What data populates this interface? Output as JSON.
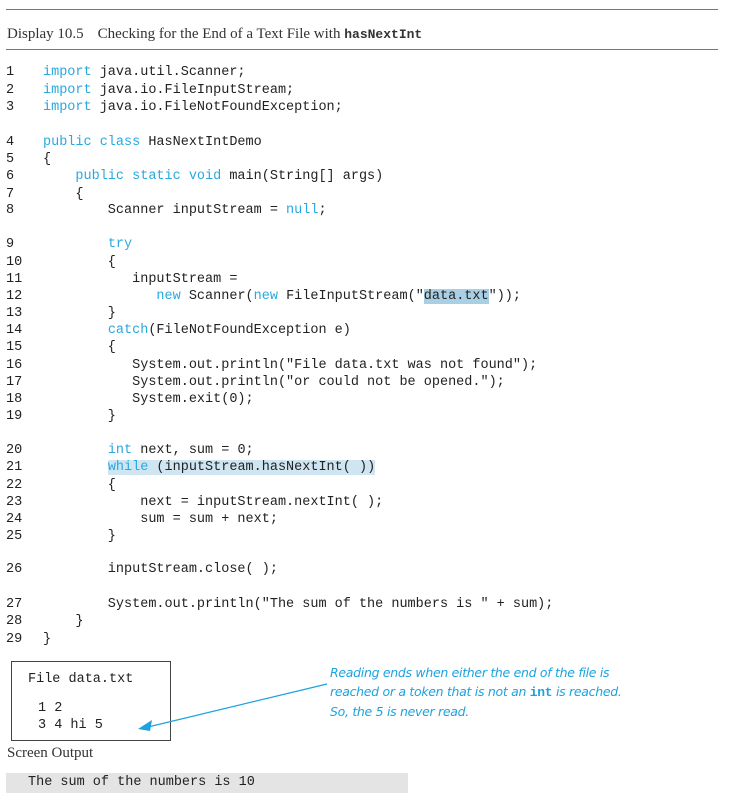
{
  "header": {
    "display_number": "Display 10.5",
    "title_text": "Checking for the End of a Text File with ",
    "title_code": "hasNextInt"
  },
  "code_lines": [
    {
      "n": "1",
      "parts": [
        {
          "t": "import",
          "k": 1
        },
        {
          "t": " java.util.Scanner;"
        }
      ]
    },
    {
      "n": "2",
      "parts": [
        {
          "t": "import",
          "k": 1
        },
        {
          "t": " java.io.FileInputStream;"
        }
      ]
    },
    {
      "n": "3",
      "parts": [
        {
          "t": "import",
          "k": 1
        },
        {
          "t": " java.io.FileNotFoundException;"
        }
      ]
    },
    {
      "n": "4",
      "parts": [
        {
          "t": "public class",
          "k": 1
        },
        {
          "t": " HasNextIntDemo"
        }
      ]
    },
    {
      "n": "5",
      "parts": [
        {
          "t": "{"
        }
      ]
    },
    {
      "n": "6",
      "parts": [
        {
          "t": "    "
        },
        {
          "t": "public static void",
          "k": 1
        },
        {
          "t": " main(String[] args)"
        }
      ]
    },
    {
      "n": "7",
      "parts": [
        {
          "t": "    {"
        }
      ]
    },
    {
      "n": "8",
      "parts": [
        {
          "t": "        Scanner inputStream = "
        },
        {
          "t": "null",
          "k": 1
        },
        {
          "t": ";"
        }
      ]
    },
    {
      "n": "9",
      "parts": [
        {
          "t": "        "
        },
        {
          "t": "try",
          "k": 1
        }
      ]
    },
    {
      "n": "10",
      "parts": [
        {
          "t": "        {"
        }
      ]
    },
    {
      "n": "11",
      "parts": [
        {
          "t": "           inputStream ="
        }
      ]
    },
    {
      "n": "12",
      "parts": [
        {
          "t": "              "
        },
        {
          "t": "new",
          "k": 1
        },
        {
          "t": " Scanner("
        },
        {
          "t": "new",
          "k": 1
        },
        {
          "t": " FileInputStream(\""
        },
        {
          "t": "data.txt",
          "h": 2
        },
        {
          "t": "\"));"
        }
      ]
    },
    {
      "n": "13",
      "parts": [
        {
          "t": "        }"
        }
      ]
    },
    {
      "n": "14",
      "parts": [
        {
          "t": "        "
        },
        {
          "t": "catch",
          "k": 1
        },
        {
          "t": "(FileNotFoundException e)"
        }
      ]
    },
    {
      "n": "15",
      "parts": [
        {
          "t": "        {"
        }
      ]
    },
    {
      "n": "16",
      "parts": [
        {
          "t": "           System.out.println(\"File data.txt was not found\");"
        }
      ]
    },
    {
      "n": "17",
      "parts": [
        {
          "t": "           System.out.println(\"or could not be opened.\");"
        }
      ]
    },
    {
      "n": "18",
      "parts": [
        {
          "t": "           System.exit(0);"
        }
      ]
    },
    {
      "n": "19",
      "parts": [
        {
          "t": "        }"
        }
      ]
    },
    {
      "n": "20",
      "parts": [
        {
          "t": "        "
        },
        {
          "t": "int",
          "k": 1
        },
        {
          "t": " next, sum = 0;"
        }
      ]
    },
    {
      "n": "21",
      "parts": [
        {
          "t": "        "
        },
        {
          "t": "while",
          "k": 1,
          "h": 1
        },
        {
          "t": " (inputStream.hasNextInt( ))",
          "h": 1
        }
      ]
    },
    {
      "n": "22",
      "parts": [
        {
          "t": "        {"
        }
      ]
    },
    {
      "n": "23",
      "parts": [
        {
          "t": "            next = inputStream.nextInt( );"
        }
      ]
    },
    {
      "n": "24",
      "parts": [
        {
          "t": "            sum = sum + next;"
        }
      ]
    },
    {
      "n": "25",
      "parts": [
        {
          "t": "        }"
        }
      ]
    },
    {
      "n": "26",
      "parts": [
        {
          "t": "        inputStream.close( );"
        }
      ]
    },
    {
      "n": "27",
      "parts": [
        {
          "t": "        System.out.println(\"The sum of the numbers is \" + sum);"
        }
      ]
    },
    {
      "n": "28",
      "parts": [
        {
          "t": "    }"
        }
      ]
    },
    {
      "n": "29",
      "parts": [
        {
          "t": "}"
        }
      ]
    }
  ],
  "file_box": {
    "title": "File data.txt",
    "lines": [
      "1 2",
      "3 4 hi 5"
    ]
  },
  "annotation": {
    "line1": "Reading ends when either the end of the file is",
    "line2_pre": "reached or a token that is not an ",
    "line2_code": "int",
    "line2_post": " is reached.",
    "line3": "So, the 5 is never read."
  },
  "screen_output": {
    "label": "Screen Output",
    "text": "The sum of the numbers is 10"
  },
  "colors": {
    "keyword": "#29a8e0",
    "annotation": "#1ba3e0",
    "highlight_line": "#cfe6f2",
    "highlight_string": "#a9cfe5",
    "output_bg": "#e4e4e4"
  }
}
